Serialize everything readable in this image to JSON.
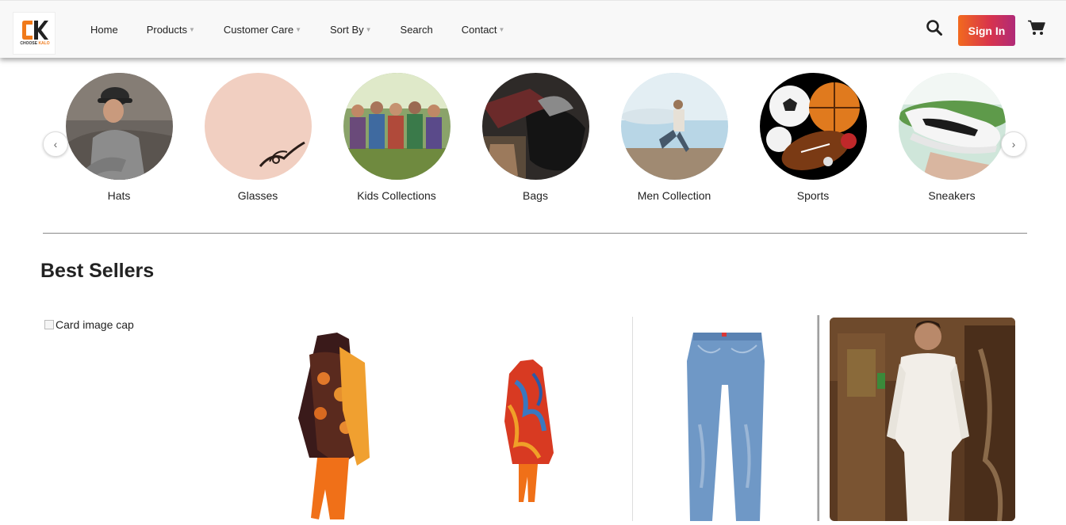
{
  "brand": {
    "logo_text_a": "CHOOSE",
    "logo_text_b": "KALO"
  },
  "nav": {
    "items": [
      {
        "label": "Home",
        "dropdown": false
      },
      {
        "label": "Products",
        "dropdown": true
      },
      {
        "label": "Customer Care",
        "dropdown": true
      },
      {
        "label": "Sort By",
        "dropdown": true
      },
      {
        "label": "Search",
        "dropdown": false
      },
      {
        "label": "Contact",
        "dropdown": true
      }
    ],
    "signin_label": "Sign In",
    "search_icon": "search-icon",
    "cart_icon": "cart-icon"
  },
  "categories": [
    {
      "label": "Hats"
    },
    {
      "label": "Glasses"
    },
    {
      "label": "Kids Collections"
    },
    {
      "label": "Bags"
    },
    {
      "label": "Men Collection"
    },
    {
      "label": "Sports"
    },
    {
      "label": "Sneakers"
    }
  ],
  "carousel": {
    "prev_icon": "chevron-left-icon",
    "next_icon": "chevron-right-icon"
  },
  "best_sellers": {
    "title": "Best Sellers",
    "broken_image_alt": "Card image cap"
  },
  "colors": {
    "signin_gradient_start": "#f26a1e",
    "signin_gradient_end": "#b02a78",
    "brand_orange": "#f07a1a"
  }
}
